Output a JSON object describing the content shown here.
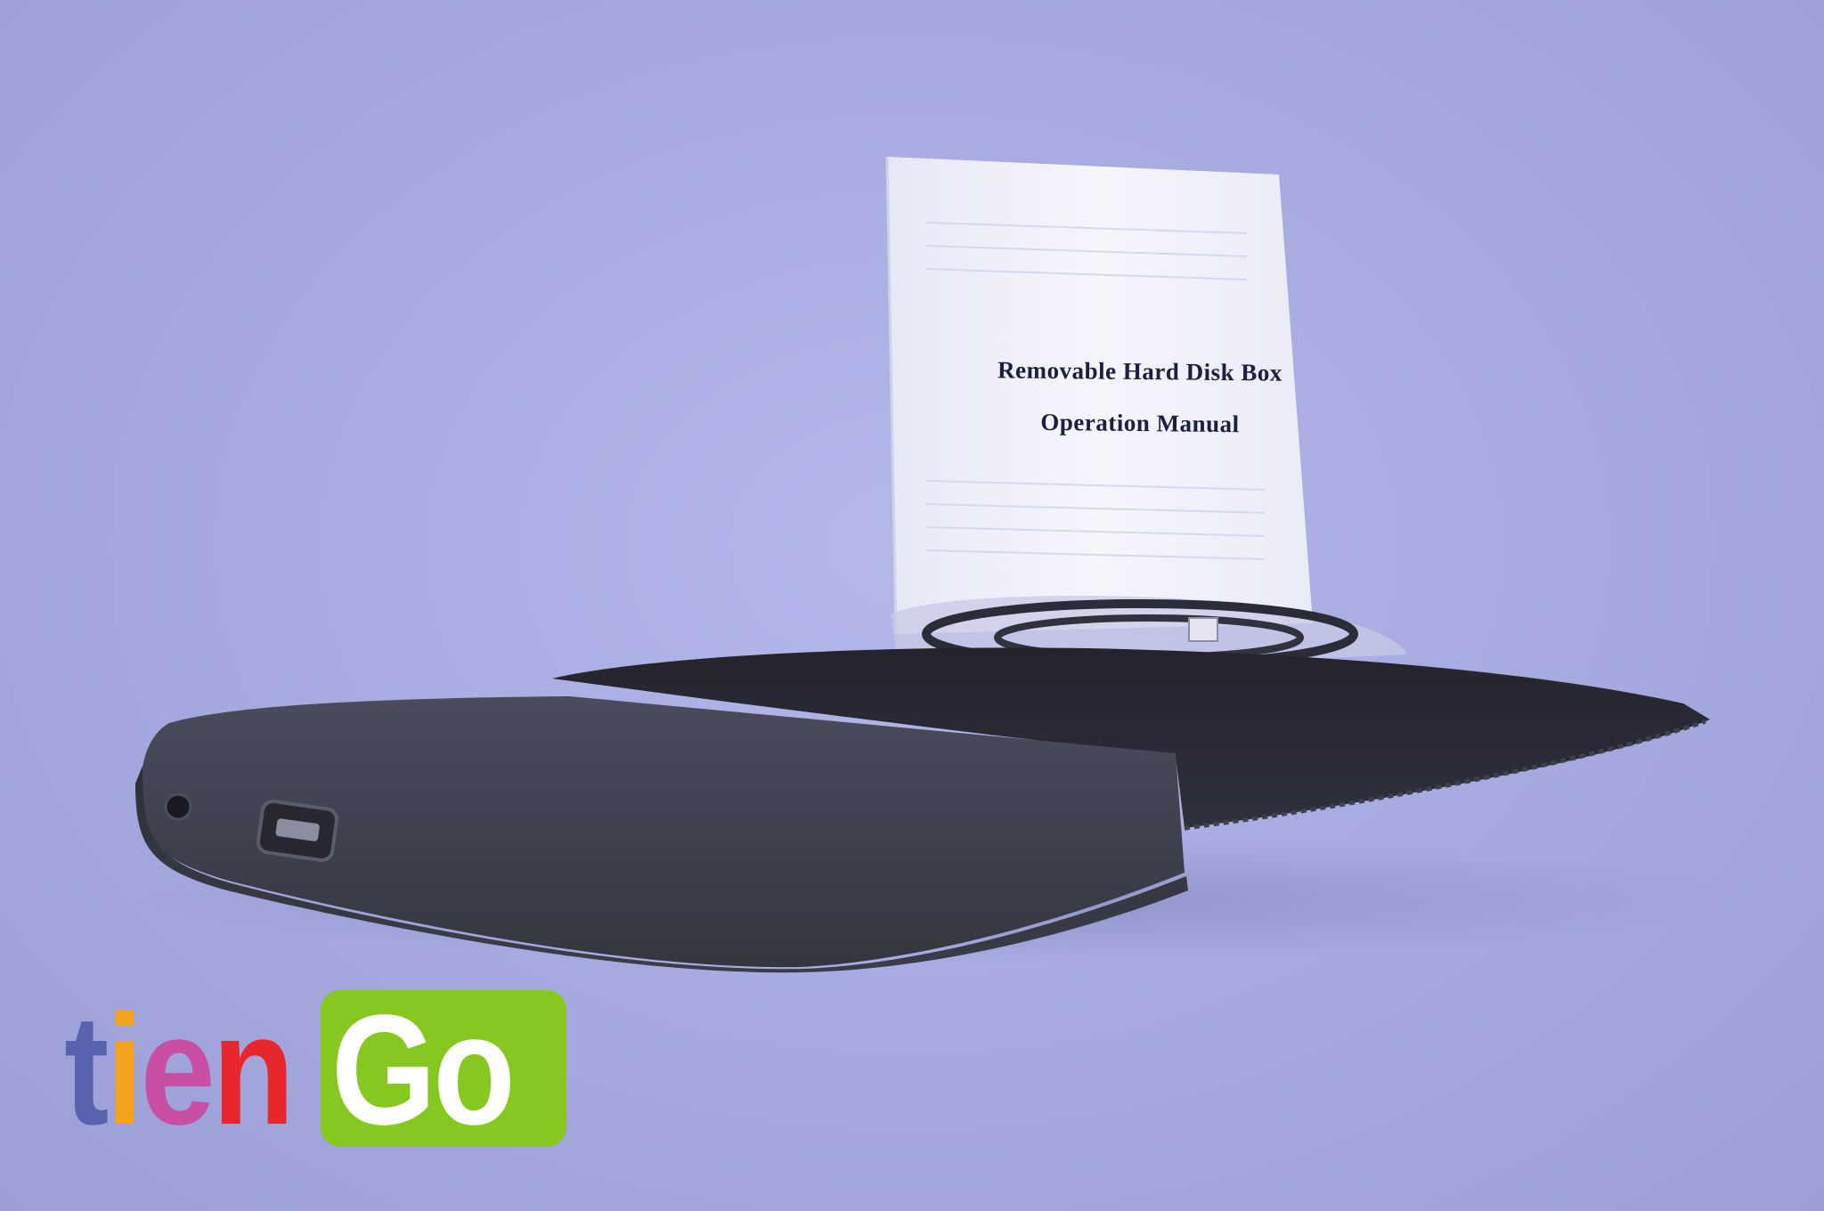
{
  "photo": {
    "manual": {
      "title_line_1": "Removable Hard Disk Box",
      "title_line_2": "Operation Manual"
    }
  },
  "watermark": {
    "letters": [
      "t",
      "i",
      "e",
      "n"
    ],
    "go": "Go",
    "colors": {
      "t": "#5a62b0",
      "i": "#f5a21c",
      "e": "#c84fa4",
      "n": "#e8262e",
      "go_box": "#86c820",
      "go_text": "#ffffff"
    }
  }
}
